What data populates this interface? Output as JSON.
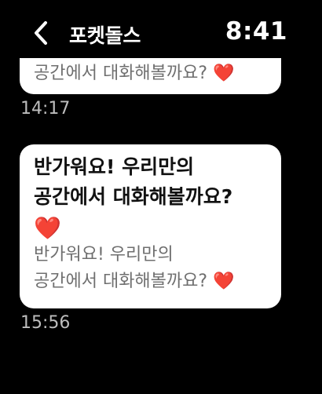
{
  "header": {
    "back_icon": "chevron-left-icon",
    "title": "포켓돌스",
    "time": "8:41"
  },
  "messages": [
    {
      "main_lines": [],
      "sub_lines": [
        "공간에서 대화해볼까요? ❤️"
      ],
      "timestamp": "14:17"
    },
    {
      "main_lines": [
        "반가워요! 우리만의",
        "공간에서 대화해볼까요?",
        "❤️"
      ],
      "sub_lines": [
        "반가워요! 우리만의",
        "공간에서 대화해볼까요? ❤️"
      ],
      "timestamp": "15:56"
    }
  ]
}
